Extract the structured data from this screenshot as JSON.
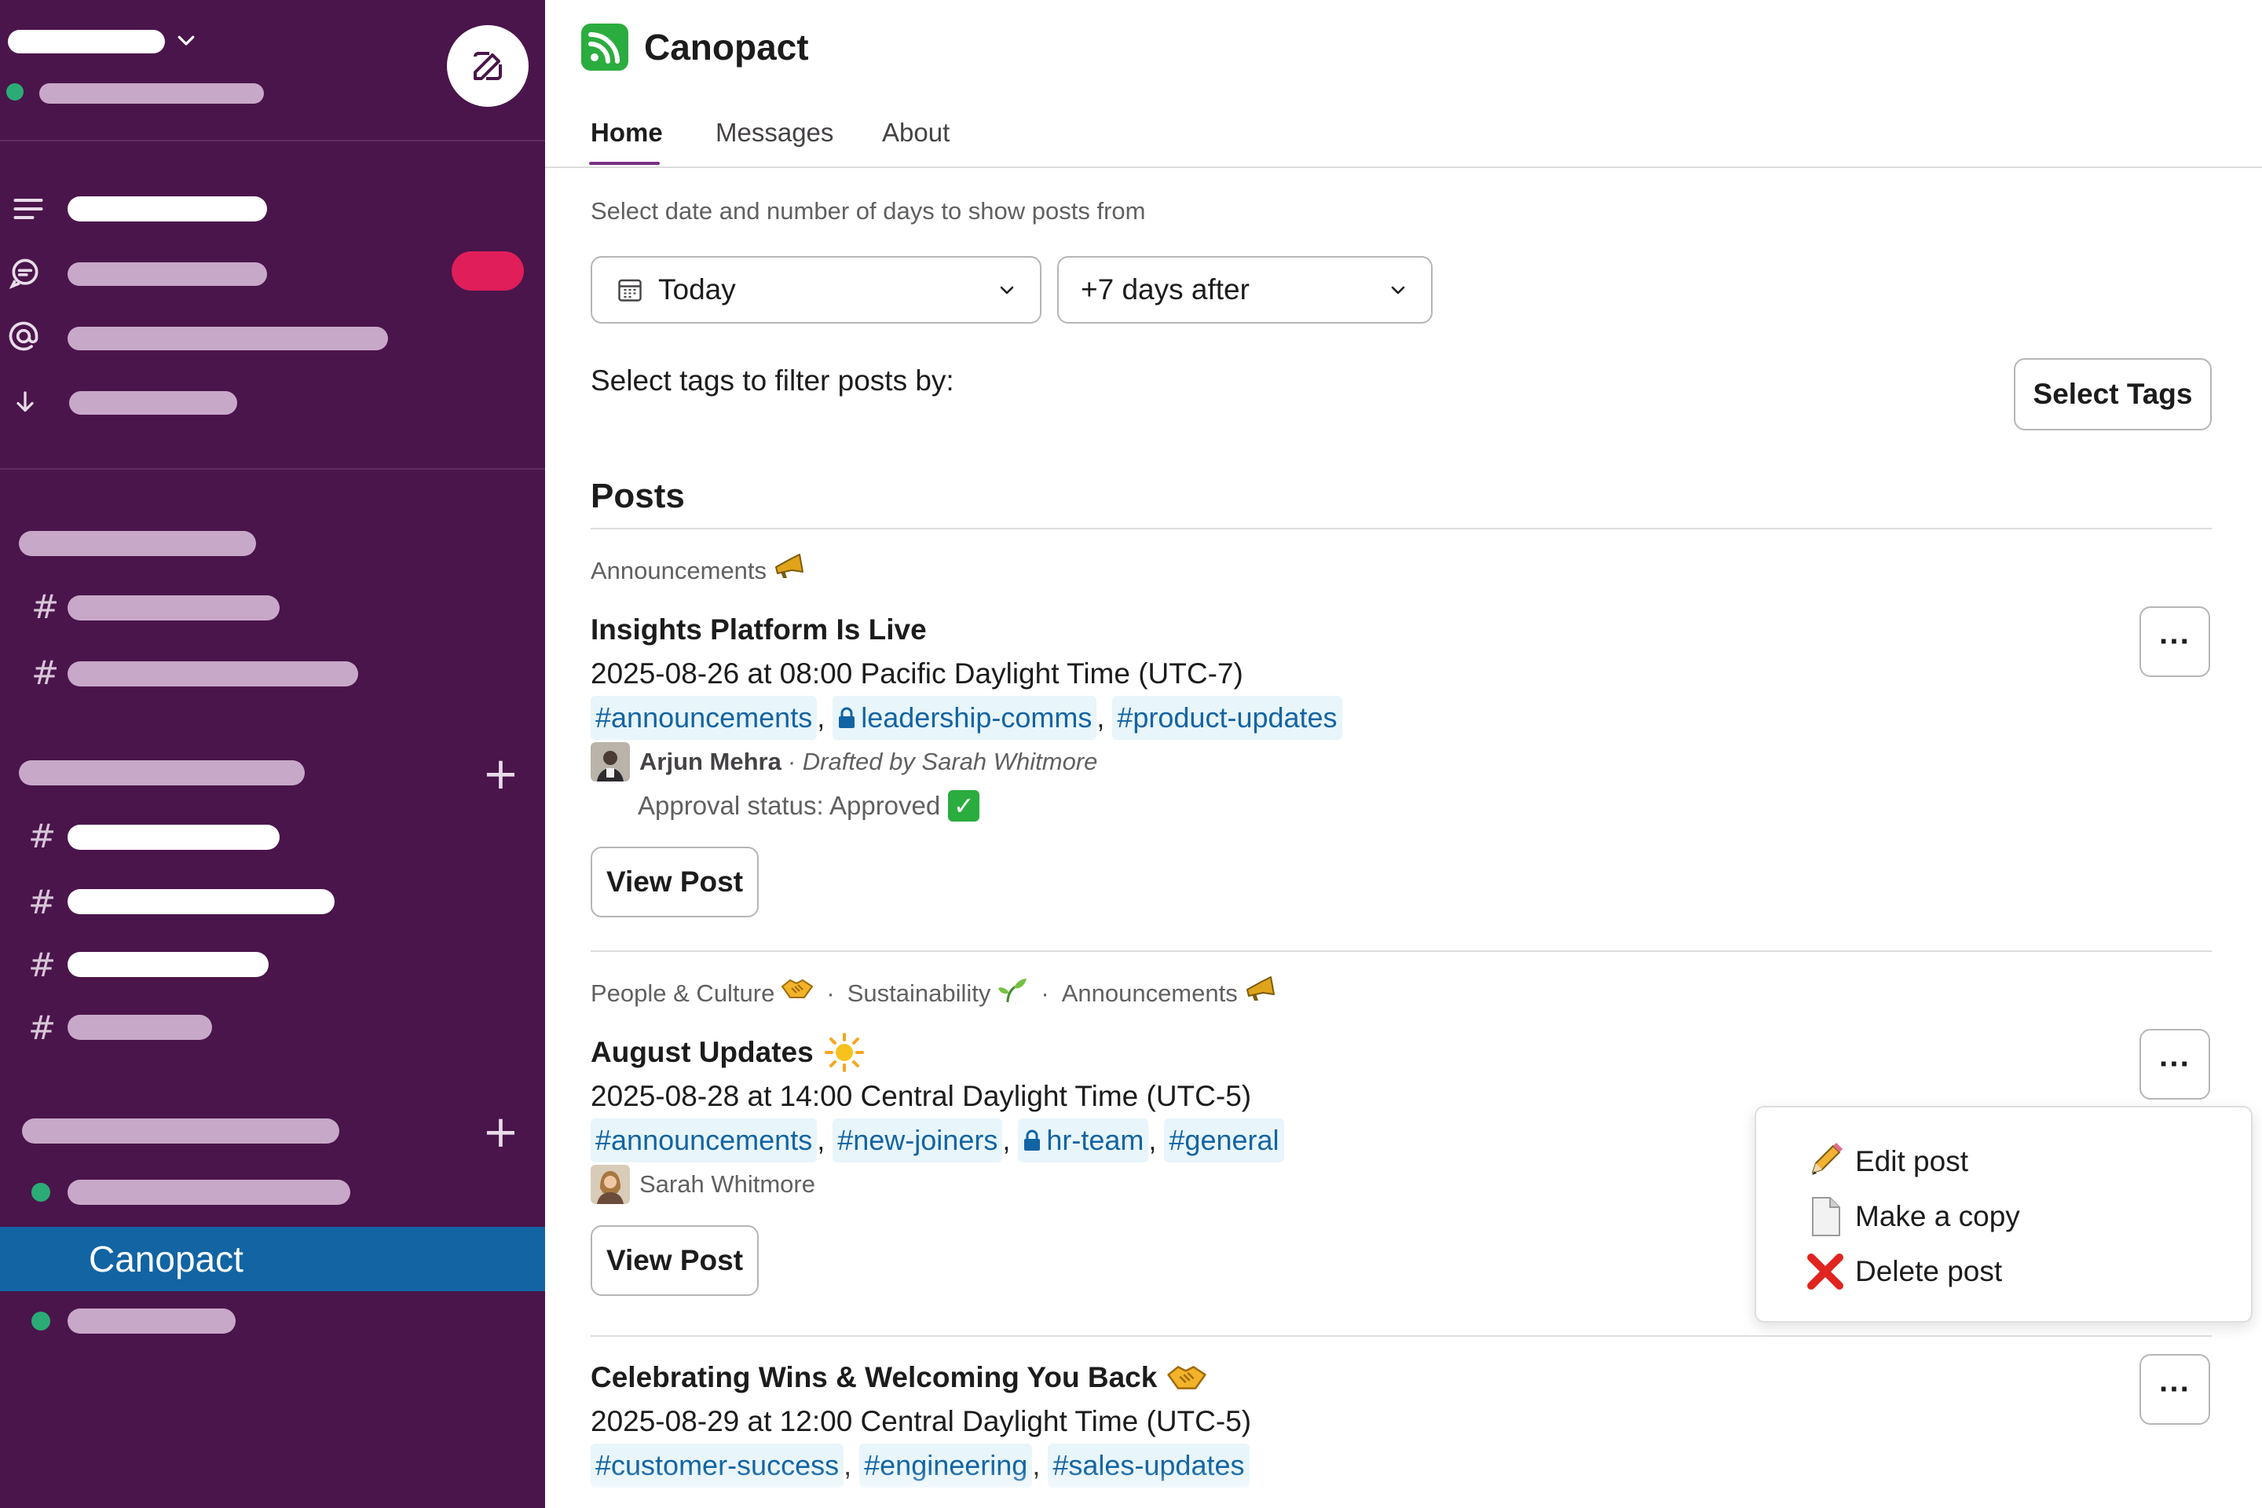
{
  "app": {
    "name": "Canopact",
    "accent": "#7c3085",
    "brand_color": "#2bac3e"
  },
  "sidebar": {
    "active_item": "Canopact",
    "bg": "#4a154b",
    "active_bg": "#1264a3"
  },
  "tabs": [
    "Home",
    "Messages",
    "About"
  ],
  "filters": {
    "date_label": "Select date and number of days to show posts from",
    "date_value": "Today",
    "days_value": "+7 days after",
    "tags_label": "Select tags to filter posts by:",
    "select_tags_button": "Select Tags"
  },
  "posts_heading": "Posts",
  "posts": [
    {
      "categories": [
        {
          "name": "Announcements",
          "icon": "megaphone-icon"
        }
      ],
      "title": "Insights Platform Is Live",
      "title_icon": "",
      "time": "2025-08-26 at 08:00 Pacific Daylight Time (UTC-7)",
      "channels": [
        {
          "name": "#announcements",
          "private": false
        },
        {
          "name": "leadership-comms",
          "private": true
        },
        {
          "name": "#product-updates",
          "private": false
        }
      ],
      "author": "Arjun Mehra",
      "drafted_by": "· Drafted by Sarah Whitmore",
      "approval": "Approval status: Approved",
      "view_button": "View Post",
      "more_button": "···"
    },
    {
      "categories": [
        {
          "name": "People & Culture",
          "icon": "handshake-icon"
        },
        {
          "name": "Sustainability",
          "icon": "seedling-icon"
        },
        {
          "name": "Announcements",
          "icon": "megaphone-icon"
        }
      ],
      "category_separator": "·",
      "title": "August Updates",
      "title_icon": "sun-icon",
      "time": "2025-08-28 at 14:00 Central Daylight Time (UTC-5)",
      "channels": [
        {
          "name": "#announcements",
          "private": false
        },
        {
          "name": "#new-joiners",
          "private": false
        },
        {
          "name": "hr-team",
          "private": true
        },
        {
          "name": "#general",
          "private": false
        }
      ],
      "author": "Sarah Whitmore",
      "view_button": "View Post",
      "more_button": "···"
    },
    {
      "title": "Celebrating Wins & Welcoming You Back",
      "title_icon": "handshake-icon",
      "time": "2025-08-29 at 12:00 Central Daylight Time (UTC-5)",
      "channels": [
        {
          "name": "#customer-success",
          "private": false
        },
        {
          "name": "#engineering",
          "private": false
        },
        {
          "name": "#sales-updates",
          "private": false
        }
      ],
      "more_button": "···"
    }
  ],
  "post_menu": [
    {
      "label": "Edit post",
      "icon": "pencil-icon"
    },
    {
      "label": "Make a copy",
      "icon": "document-icon"
    },
    {
      "label": "Delete post",
      "icon": "red-x-icon"
    }
  ]
}
